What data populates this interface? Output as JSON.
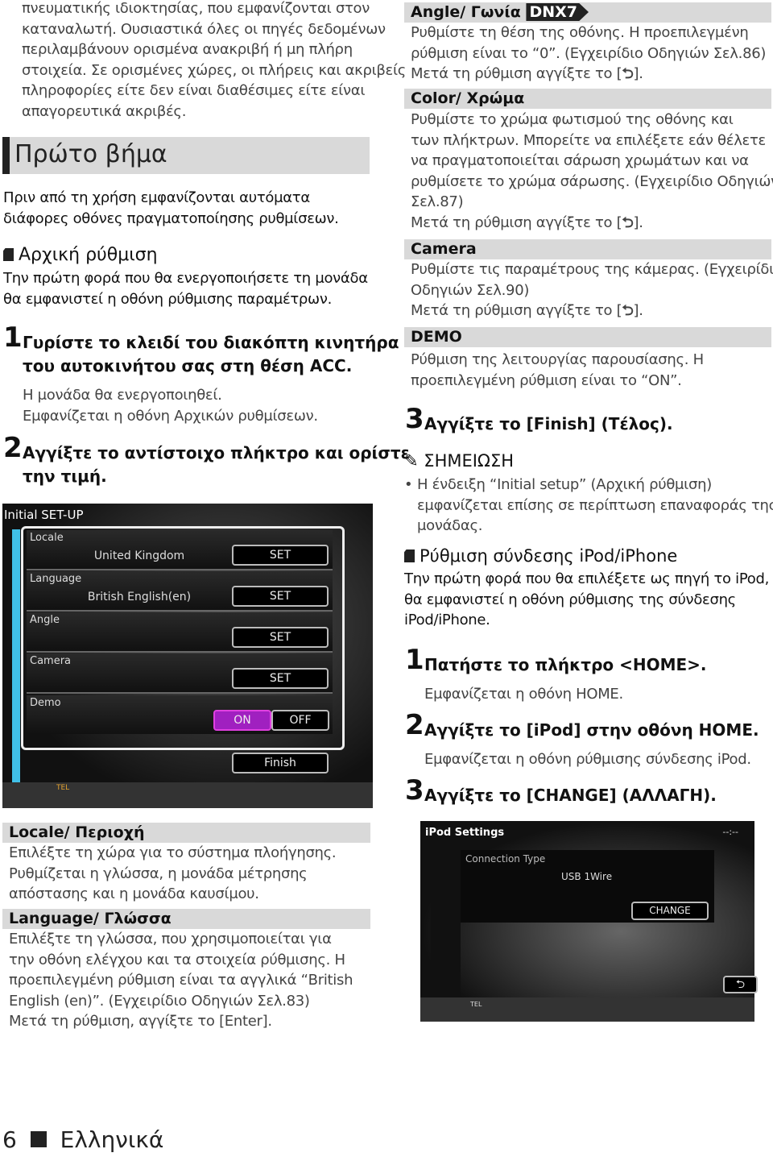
{
  "left": {
    "intro": [
      "πνευματικής ιδιοκτησίας, που εμφανίζονται στον",
      "καταναλωτή. Ουσιαστικά όλες οι πηγές δεδομένων",
      "περιλαμβάνουν ορισμένα ανακριβή ή μη πλήρη",
      "στοιχεία. Σε ορισμένες χώρες, οι πλήρεις και ακριβείς",
      "πληροφορίες είτε δεν είναι διαθέσιμες είτε είναι",
      "απαγορευτικά ακριβές."
    ],
    "heading": "Πρώτο βήμα",
    "heading_text": [
      "Πριν από τη χρήση εμφανίζονται αυτόματα",
      "διάφορες οθόνες πραγματοποίησης ρυθμίσεων."
    ],
    "sub": "Αρχική ρύθμιση",
    "sub_text": [
      "Την πρώτη φορά που θα ενεργοποιήσετε τη μονάδα",
      "θα εμφανιστεί η οθόνη ρύθμισης παραμέτρων."
    ],
    "step1": {
      "n": "1",
      "lines": [
        "Γυρίστε το κλειδί του διακόπτη κινητήρα",
        "του αυτοκινήτου σας στη θέση ACC."
      ],
      "notes": [
        "Η μονάδα θα ενεργοποιηθεί.",
        "Εμφανίζεται η οθόνη Αρχικών ρυθμίσεων."
      ]
    },
    "step2": {
      "n": "2",
      "lines": [
        "Αγγίξτε το αντίστοιχο πλήκτρο και ορίστε",
        "την τιμή."
      ]
    },
    "locale": {
      "title": "Locale/ Περιοχή",
      "lines": [
        "Επιλέξτε τη χώρα για το σύστημα πλοήγησης.",
        "Ρυθμίζεται η γλώσσα, η μονάδα μέτρησης",
        "απόστασης και η μονάδα καυσίμου."
      ]
    },
    "language": {
      "title": "Language/ Γλώσσα",
      "lines": [
        "Επιλέξτε τη γλώσσα, που χρησιμοποιείται για",
        "την οθόνη ελέγχου και τα στοιχεία ρύθμισης. Η",
        "προεπιλεγμένη ρύθμιση είναι τα αγγλικά “British",
        "English (en)”. (Εγχειρίδιο Οδηγιών Σελ.83)",
        "Μετά τη ρύθμιση, αγγίξτε το [Enter]."
      ]
    }
  },
  "screen1": {
    "title": "Initial SET-UP",
    "rows": [
      {
        "label": "Locale",
        "value": "United Kingdom",
        "btn": "SET"
      },
      {
        "label": "Language",
        "value": "British English(en)",
        "btn": "SET"
      },
      {
        "label": "Angle",
        "value": "",
        "btn": "SET"
      },
      {
        "label": "Camera",
        "value": "",
        "btn": "SET"
      }
    ],
    "demo": {
      "label": "Demo",
      "on": "ON",
      "off": "OFF"
    },
    "finish": "Finish",
    "tel": "TEL",
    "accent": "#40c0e8",
    "on_color": "#a020c0"
  },
  "right": {
    "angle": {
      "title": "Angle/ Γωνία",
      "badge": "DNX7",
      "lines": [
        "Ρυθμίστε τη θέση της οθόνης. Η προεπιλεγμένη",
        "ρύθμιση είναι το “0”. (Εγχειρίδιο Οδηγιών Σελ.86)"
      ],
      "after": "Μετά τη ρύθμιση αγγίξτε το ["
    },
    "color": {
      "title": "Color/ Χρώμα",
      "lines": [
        "Ρυθμίστε το χρώμα φωτισμού της οθόνης και",
        "των πλήκτρων. Μπορείτε να επιλέξετε εάν θέλετε",
        "να πραγματοποιείται σάρωση χρωμάτων και να",
        "ρυθμίσετε το χρώμα σάρωσης. (Εγχειρίδιο Οδηγιών",
        "Σελ.87)"
      ],
      "after": "Μετά τη ρύθμιση αγγίξτε το ["
    },
    "camera": {
      "title": "Camera",
      "lines": [
        "Ρυθμίστε τις παραμέτρους της κάμερας. (Εγχειρίδιο",
        "Οδηγιών Σελ.90)"
      ],
      "after": "Μετά τη ρύθμιση αγγίξτε το ["
    },
    "demo": {
      "title": "DEMO",
      "lines": [
        "Ρύθμιση της λειτουργίας παρουσίασης. Η",
        "προεπιλεγμένη ρύθμιση είναι το “ON”."
      ]
    },
    "close": "].",
    "step3": {
      "n": "3",
      "text": "Αγγίξτε το [Finish] (Τέλος)."
    },
    "note": {
      "title": "ΣΗΜΕΙΩΣΗ",
      "lines": [
        "Η ένδειξη “Initial setup” (Αρχική ρύθμιση)",
        "εμφανίζεται επίσης σε περίπτωση επαναφοράς της",
        "μονάδας."
      ]
    },
    "ipod": {
      "title": "Ρύθμιση σύνδεσης iPod/iPhone",
      "lines": [
        "Την πρώτη φορά που θα επιλέξετε ως πηγή το iPod,",
        "θα εμφανιστεί η οθόνη ρύθμισης της σύνδεσης",
        "iPod/iPhone."
      ]
    },
    "s1": {
      "n": "1",
      "text": "Πατήστε το πλήκτρο <HOME>.",
      "note": "Εμφανίζεται η οθόνη HOME."
    },
    "s2": {
      "n": "2",
      "text": "Αγγίξτε το [iPod] στην οθόνη HOME.",
      "note": "Εμφανίζεται η οθόνη ρύθμισης σύνδεσης iPod."
    },
    "s3": {
      "n": "3",
      "text": "Αγγίξτε το [CHANGE] (ΑΛΛΑΓΗ)."
    }
  },
  "screen2": {
    "title": "iPod Settings",
    "clock": "--:--",
    "label": "Connection Type",
    "value": "USB 1Wire",
    "btn": "CHANGE",
    "tel": "TEL"
  },
  "footer": {
    "page": "6",
    "lang": "Ελληνικά"
  }
}
